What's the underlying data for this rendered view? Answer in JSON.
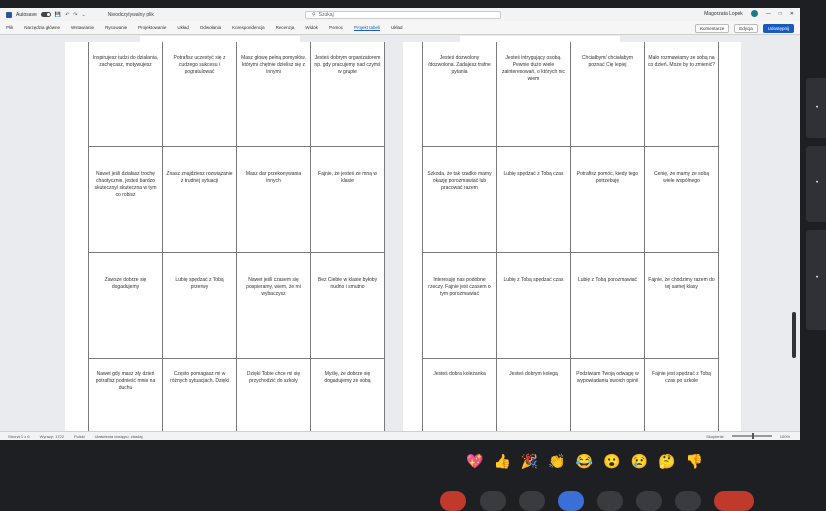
{
  "titlebar": {
    "autosave_label": "Autosave",
    "doc_title": "Nieodczytywalny plik",
    "search_placeholder": "Szukaj",
    "user_name": "Magorzata Lopek",
    "minimize": "—",
    "maximize": "□",
    "close": "✕"
  },
  "ribbon": {
    "tabs": [
      "Plik",
      "Narzędzia główne",
      "Wstawianie",
      "Rysowanie",
      "Projektowanie",
      "Układ",
      "Odwołania",
      "Korespondencja",
      "Recenzja",
      "Widok",
      "Pomoc",
      "Projekt tabeli",
      "Układ"
    ],
    "active_tab": 11,
    "comments_label": "Komentarze",
    "edit_label": "Edycja",
    "share_label": "Udostępnij"
  },
  "pageA": {
    "rows": [
      [
        "Inspirujesz tudzi do działania, zachęcasz, motywujesz",
        "Potrafisz uczestyć się z cudzego sukcesu i pogratulować",
        "Masz głowę pełną pomysłów, którymi chętnie dzielisz się z innymi",
        "Jesteś dobrym organizatorem np. gdy pracujemy nad czymś w grupie"
      ],
      [
        "Nawet jeśli działasz trochę chaotycznie, jesteś bardzo skuteczny/ skuteczna w tym co robisz",
        "Znasz znajdziesz rozwiązanie z trudnej sytuacji",
        "Masz dar przekonywania innych",
        "Fajnie, że jesteś ze mną w klasie"
      ],
      [
        "Zawsze dobrze się dogadujemy",
        "Lubię spędzać z Tobą przerwy",
        "Nawet jeśli czasem się pospieramy, wiem, że mi wybaczysz",
        "Bez Ciebie w klasie byłoby nudno i smutno"
      ],
      [
        "Nawet gdy masz zły dzień potrafisz podnieść mnie na duchu",
        "Często pomagasz mi w różnych sytuacjach. Dzięki",
        "Dzięki Tobie chce mi się przychodzić do szkoły",
        "Myślę, że dobrze się dogadujemy ze sobą"
      ]
    ]
  },
  "pageB": {
    "rows": [
      [
        "Jesteś dozwolony /dozwolona. Zadajesz trafne pytania",
        "Jesteś intrygujący osobą. Pewnie dużo wiele zainteresowań, o których nic wiem",
        "Chciałbym/ chciałabym poznać Cię lepiej",
        "Mało rozmawiamy ze sobą na co dzień. Może by to zmienić?"
      ],
      [
        "Szkoda, że tak rzadko mamy okazję porozmawiać lub pracować razem",
        "Lubię spędzać z Tobą czas",
        "Potrafisz pomóc, kiedy tego potrzebuję",
        "Cenię, że mamy ze sobą wiele wspólnego"
      ],
      [
        "Interesuję nas podobne rzeczy. Fajnie jest czasem o tym porozmawiać",
        "Lubię z Tobą spędzać czas",
        "Lubię z Tobą porozmawiać",
        "Fajnie, że chodzimy razem do tej samej klasy"
      ],
      [
        "Jesteś dobra koleżanka",
        "Jesteś dobrym kolegą",
        "Podziwiam Twoją odwagę w wypowiadaniu swoich opinii",
        "Fajnie jest spędzać z Tobą czas po szkole"
      ]
    ]
  },
  "statusbar": {
    "page": "Strona 1 z 6",
    "words": "Wyrazy: 1722",
    "lang": "Polski",
    "accessibility": "Ułatwienia dostępu: zbadaj",
    "focus": "Skupienie",
    "zoom": "100%"
  },
  "reactions": [
    "💖",
    "👍",
    "🎉",
    "👏",
    "😂",
    "😮",
    "😢",
    "🤔",
    "👎"
  ],
  "colors": {
    "accent": "#185abd",
    "call_end": "#c0392b",
    "screen_share": "#3b6fd8",
    "background": "#1e1f22"
  }
}
